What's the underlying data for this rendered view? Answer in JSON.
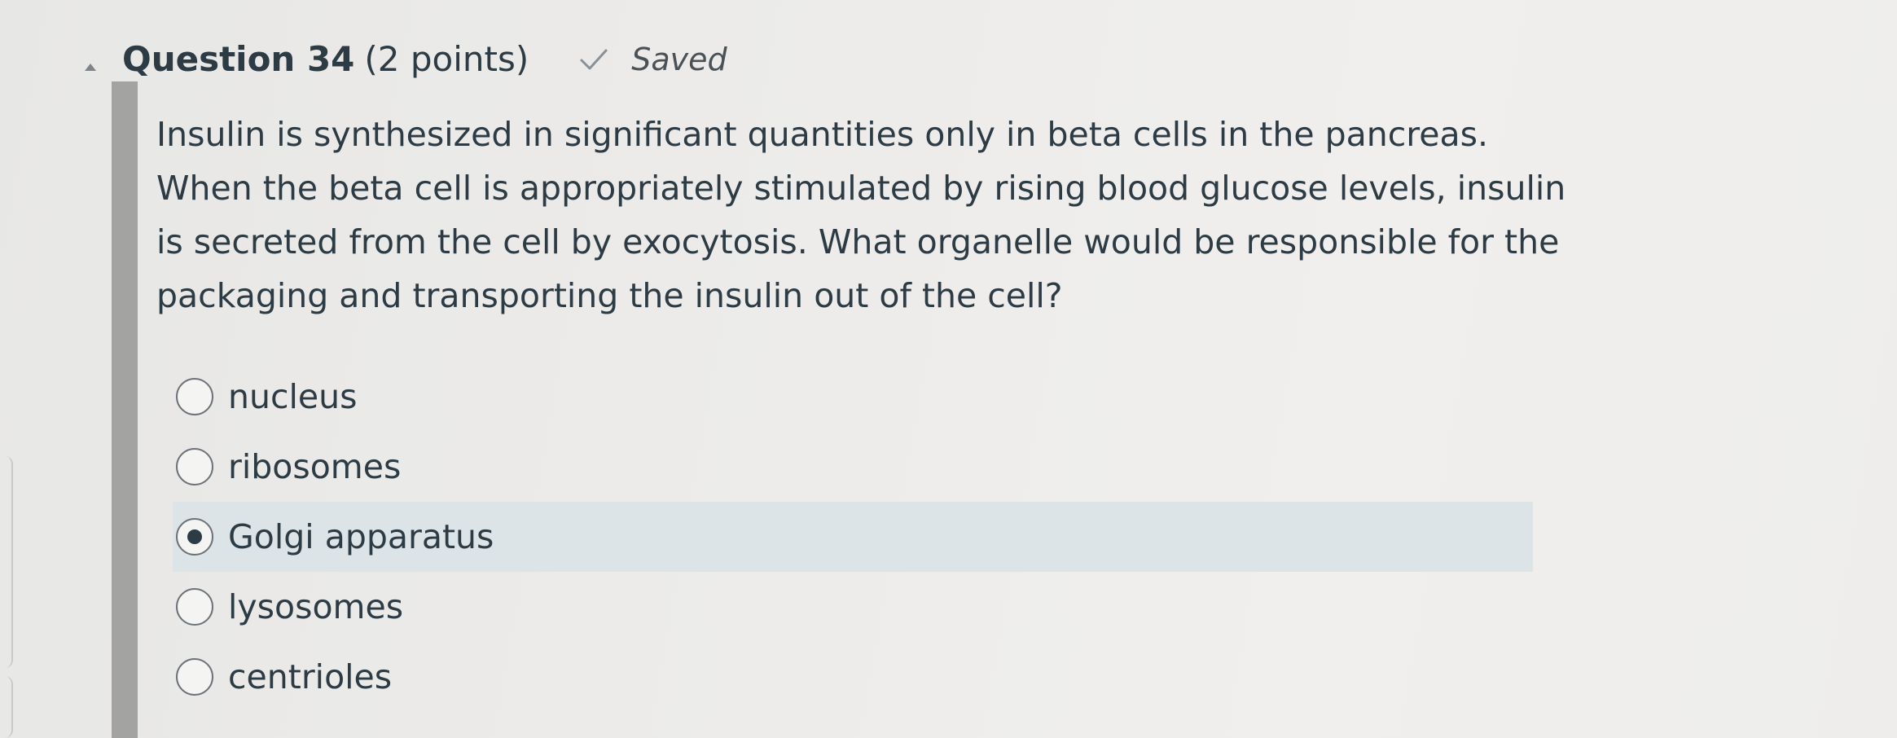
{
  "question": {
    "title": "Question 34",
    "points": "(2 points)",
    "status": "Saved",
    "text": "Insulin is synthesized in significant quantities only in beta cells in the pancreas. When the beta cell is appropriately stimulated by rising blood glucose levels, insulin is secreted from the cell by exocytosis. What organelle would be responsible for the packaging and transporting the insulin out of the cell?",
    "answers": [
      {
        "label": "nucleus",
        "selected": false
      },
      {
        "label": "ribosomes",
        "selected": false
      },
      {
        "label": "Golgi apparatus",
        "selected": true
      },
      {
        "label": "lysosomes",
        "selected": false
      },
      {
        "label": "centrioles",
        "selected": false
      }
    ]
  },
  "icons": {
    "collapse": "caret-up-icon",
    "status": "checkmark-icon"
  },
  "colors": {
    "text": "#2d3b45",
    "selected_background": "#dde4e7",
    "question_bar": "#a3a3a1"
  }
}
